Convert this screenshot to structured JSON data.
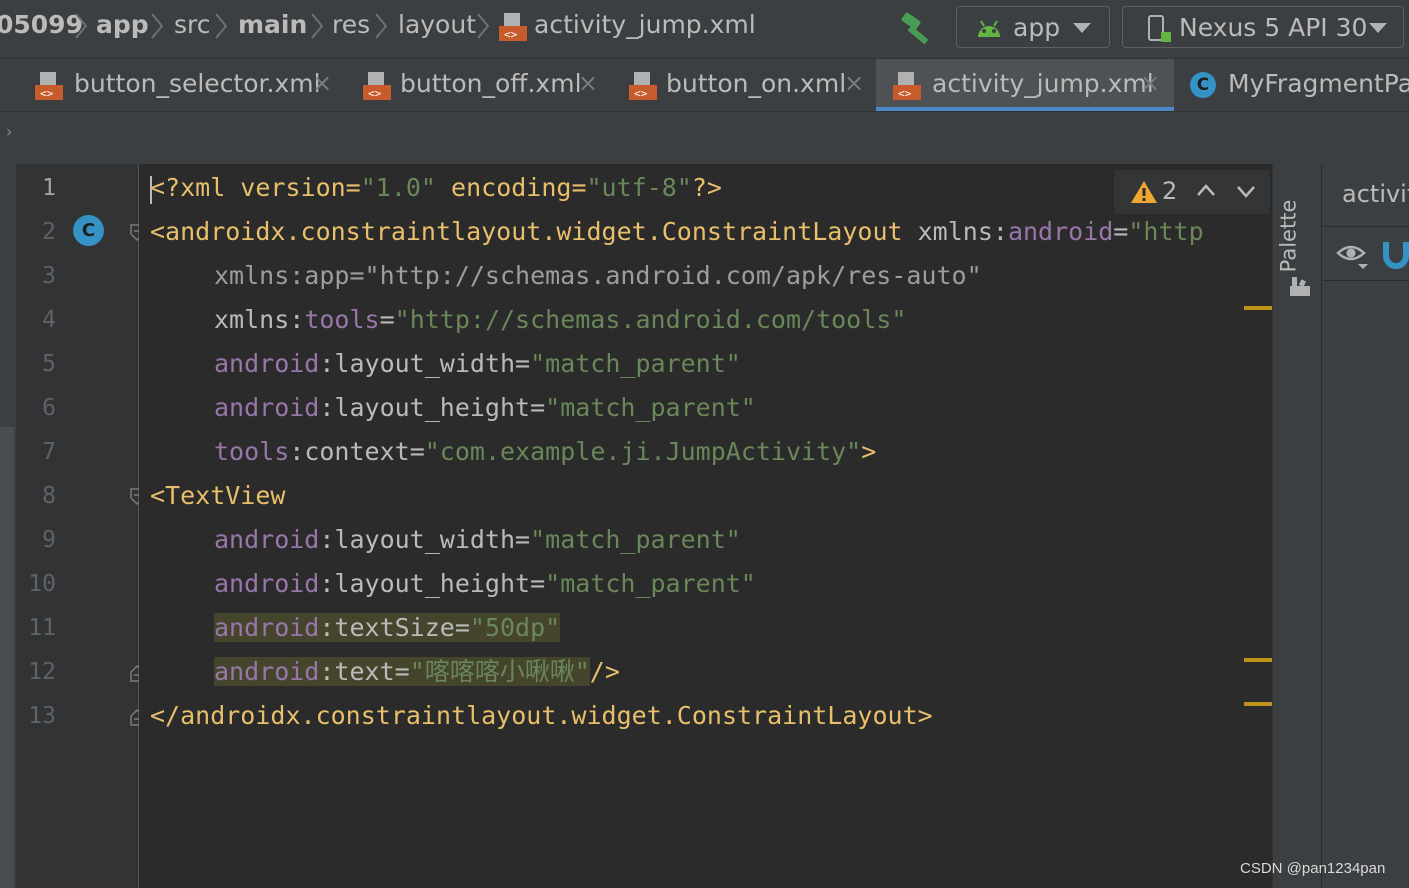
{
  "breadcrumbs": [
    {
      "label": "05099",
      "bold": true
    },
    {
      "label": "app",
      "bold": true
    },
    {
      "label": "src",
      "bold": false
    },
    {
      "label": "main",
      "bold": true
    },
    {
      "label": "res",
      "bold": false
    },
    {
      "label": "layout",
      "bold": false
    },
    {
      "label": "activity_jump.xml",
      "bold": false
    }
  ],
  "toolbar": {
    "run_config": "app",
    "device": "Nexus 5 API 30"
  },
  "tabs": [
    {
      "label": "button_selector.xml",
      "icon": "xml-file-icon",
      "active": false
    },
    {
      "label": "button_off.xml",
      "icon": "xml-file-icon",
      "active": false
    },
    {
      "label": "button_on.xml",
      "icon": "xml-file-icon",
      "active": false
    },
    {
      "label": "activity_jump.xml",
      "icon": "xml-file-icon",
      "active": true
    },
    {
      "label": "MyFragmentPag",
      "icon": "class-icon",
      "active": false
    }
  ],
  "tab_close": "×",
  "gutter": {
    "line_numbers": [
      "1",
      "2",
      "3",
      "4",
      "5",
      "6",
      "7",
      "8",
      "9",
      "10",
      "11",
      "12",
      "13"
    ],
    "class_marker": "C"
  },
  "inspections": {
    "warning_count": "2"
  },
  "code": {
    "l1": {
      "a": "<?xml version=",
      "b": "\"1.0\"",
      "c": " encoding=",
      "d": "\"utf-8\"",
      "e": "?>"
    },
    "l2": {
      "a": "<androidx.constraintlayout.widget.ConstraintLayout",
      "b": " xmlns:",
      "c": "android",
      "d": "=",
      "e": "\"http"
    },
    "l3": {
      "a": "xmlns:app=\"http://schemas.android.com/apk/res-auto\""
    },
    "l4": {
      "a": "xmlns:",
      "b": "tools",
      "c": "=",
      "d": "\"http://schemas.android.com/tools\""
    },
    "l5": {
      "a": "android",
      "b": ":layout_width",
      "c": "=",
      "d": "\"match_parent\""
    },
    "l6": {
      "a": "android",
      "b": ":layout_height",
      "c": "=",
      "d": "\"match_parent\""
    },
    "l7": {
      "a": "tools",
      "b": ":context",
      "c": "=",
      "d": "\"com.example.ji.JumpActivity\"",
      "e": ">"
    },
    "l8": {
      "a": "<TextView"
    },
    "l9": {
      "a": "android",
      "b": ":layout_width",
      "c": "=",
      "d": "\"match_parent\""
    },
    "l10": {
      "a": "android",
      "b": ":layout_height",
      "c": "=",
      "d": "\"match_parent\""
    },
    "l11": {
      "a": "android",
      "b": ":textSize",
      "c": "=",
      "d": "\"50dp\""
    },
    "l12": {
      "a": "android",
      "b": ":text",
      "c": "=",
      "d": "\"喀喀喀小啾啾\"",
      "e": "/>"
    },
    "l13": {
      "a": "</androidx.constraintlayout.widget.ConstraintLayout>"
    }
  },
  "side_panel": {
    "palette_label": "Palette",
    "design_title": "activit"
  },
  "watermark": "CSDN @pan1234pan",
  "colors": {
    "tag": "#e8bf6a",
    "namespace": "#9876aa",
    "attribute": "#bababa",
    "value": "#6a8759",
    "active_tab_underline": "#4a88c7",
    "warning": "#be9117"
  }
}
